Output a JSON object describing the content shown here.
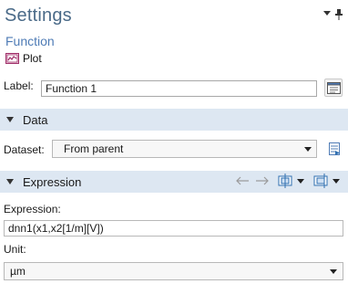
{
  "window": {
    "title": "Settings"
  },
  "node": {
    "type_label": "Function",
    "plot_button_label": "Plot"
  },
  "label_field": {
    "label": "Label:",
    "value": "Function 1"
  },
  "sections": {
    "data": {
      "title": "Data",
      "expanded": true
    },
    "expression": {
      "title": "Expression",
      "expanded": true
    }
  },
  "dataset": {
    "label": "Dataset:",
    "selected": "From parent"
  },
  "expression": {
    "label": "Expression:",
    "value": "dnn1(x1,x2[1/m][V])"
  },
  "unit": {
    "label": "Unit:",
    "selected": "µm"
  },
  "icons": {
    "window_menu": "chevron-down-icon",
    "pin": "pin-icon",
    "plot": "plot-icon",
    "label_doc": "document-edit-icon",
    "dataset_go": "goto-source-icon",
    "move_left": "arrow-left-icon",
    "move_right": "arrow-right-icon",
    "replace_expression": "replace-expression-icon",
    "insert_expression": "insert-expression-icon"
  },
  "colors": {
    "title": "#4a6a88",
    "subtitle": "#4f7cb6",
    "section_bg": "#dde7f2",
    "plot_icon": "#a0306a"
  }
}
